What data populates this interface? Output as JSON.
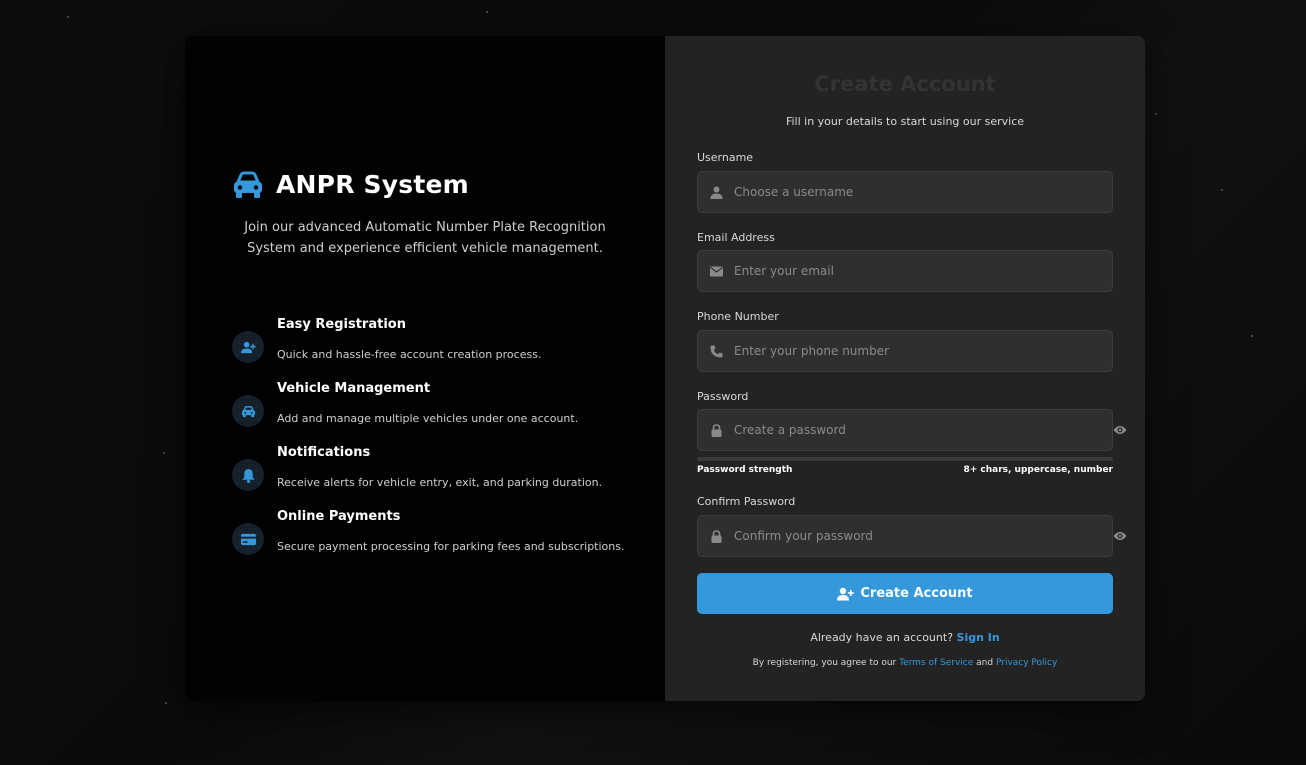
{
  "brand": {
    "title": "ANPR System",
    "tagline": "Join our advanced Automatic Number Plate Recognition System and experience efficient vehicle management.",
    "icon": "car-icon",
    "accent_color": "#3498db"
  },
  "features": [
    {
      "icon": "user-plus-icon",
      "title": "Easy Registration",
      "description": "Quick and hassle-free account creation process."
    },
    {
      "icon": "car-icon",
      "title": "Vehicle Management",
      "description": "Add and manage multiple vehicles under one account."
    },
    {
      "icon": "bell-icon",
      "title": "Notifications",
      "description": "Receive alerts for vehicle entry, exit, and parking duration."
    },
    {
      "icon": "credit-card-icon",
      "title": "Online Payments",
      "description": "Secure payment processing for parking fees and subscriptions."
    }
  ],
  "form": {
    "title": "Create Account",
    "subtitle": "Fill in your details to start using our service",
    "username": {
      "label": "Username",
      "placeholder": "Choose a username",
      "value": "",
      "icon": "user-icon"
    },
    "email": {
      "label": "Email Address",
      "placeholder": "Enter your email",
      "value": "",
      "icon": "envelope-icon"
    },
    "phone": {
      "label": "Phone Number",
      "placeholder": "Enter your phone number",
      "value": "",
      "icon": "phone-icon"
    },
    "password": {
      "label": "Password",
      "placeholder": "Create a password",
      "value": "",
      "icon": "lock-icon",
      "toggle_icon": "eye-icon"
    },
    "strength": {
      "label": "Password strength",
      "hint": "8+ chars, uppercase, number",
      "level": 0
    },
    "confirm": {
      "label": "Confirm Password",
      "placeholder": "Confirm your password",
      "value": "",
      "icon": "lock-icon",
      "toggle_icon": "eye-icon"
    },
    "submit_label": "Create Account",
    "signin_prompt": "Already have an account?",
    "signin_link": "Sign In",
    "terms_prefix": "By registering, you agree to our",
    "terms_link": "Terms of Service",
    "terms_and": "and",
    "privacy_link": "Privacy Policy"
  }
}
